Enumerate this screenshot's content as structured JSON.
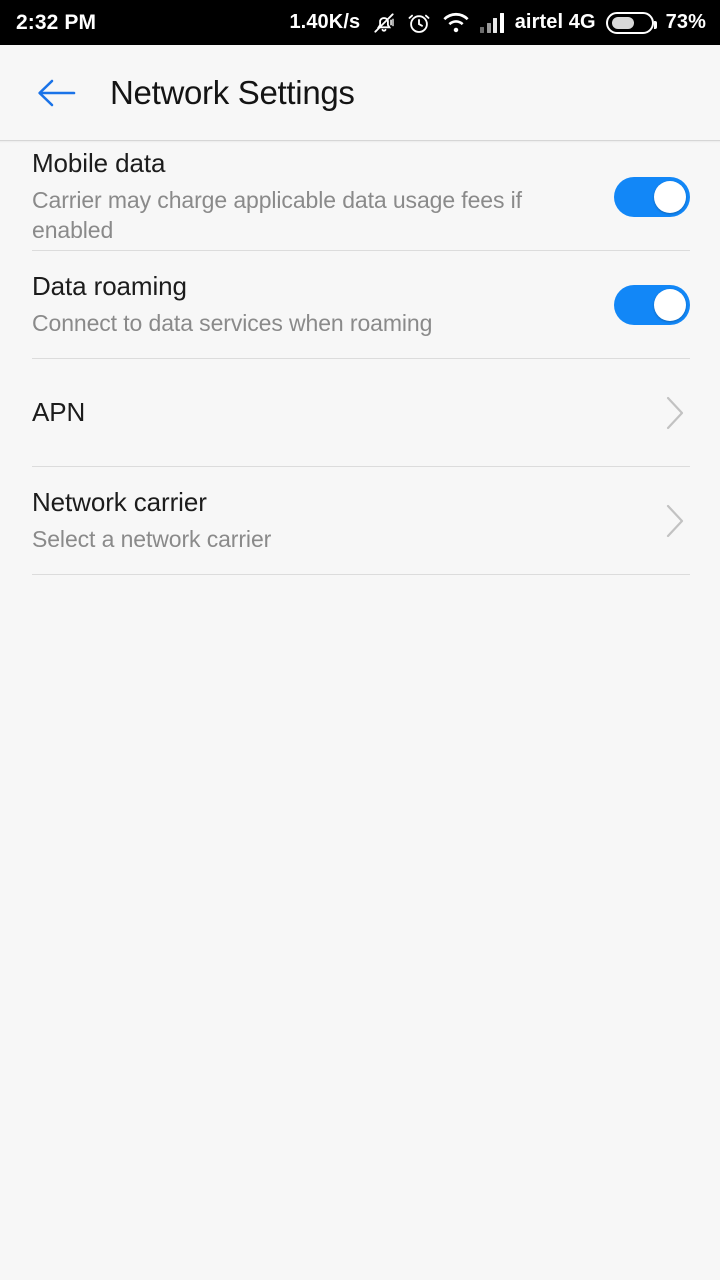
{
  "status_bar": {
    "clock": "2:32 PM",
    "network_speed": "1.40K/s",
    "icons": [
      "bell-muted-icon",
      "alarm-clock-icon",
      "wifi-icon",
      "signal-bars-icon"
    ],
    "carrier": "airtel 4G",
    "battery_percent": "73%",
    "battery_level": 73
  },
  "header": {
    "back_icon": "back-arrow-icon",
    "title": "Network Settings",
    "accent_color": "#1a73e8"
  },
  "settings": {
    "rows": [
      {
        "title": "Mobile data",
        "subtitle": "Carrier may charge applicable data usage fees if enabled",
        "control": "toggle",
        "value": "on"
      },
      {
        "title": "Data roaming",
        "subtitle": "Connect to data services when roaming",
        "control": "toggle",
        "value": "on"
      },
      {
        "title": "APN",
        "subtitle": "",
        "control": "chevron",
        "value": ""
      },
      {
        "title": "Network carrier",
        "subtitle": "Select a network carrier",
        "control": "chevron",
        "value": ""
      }
    ],
    "toggle_on_color": "#1287f7",
    "divider_color": "#dcdcdc",
    "background_color": "#f7f7f7"
  }
}
